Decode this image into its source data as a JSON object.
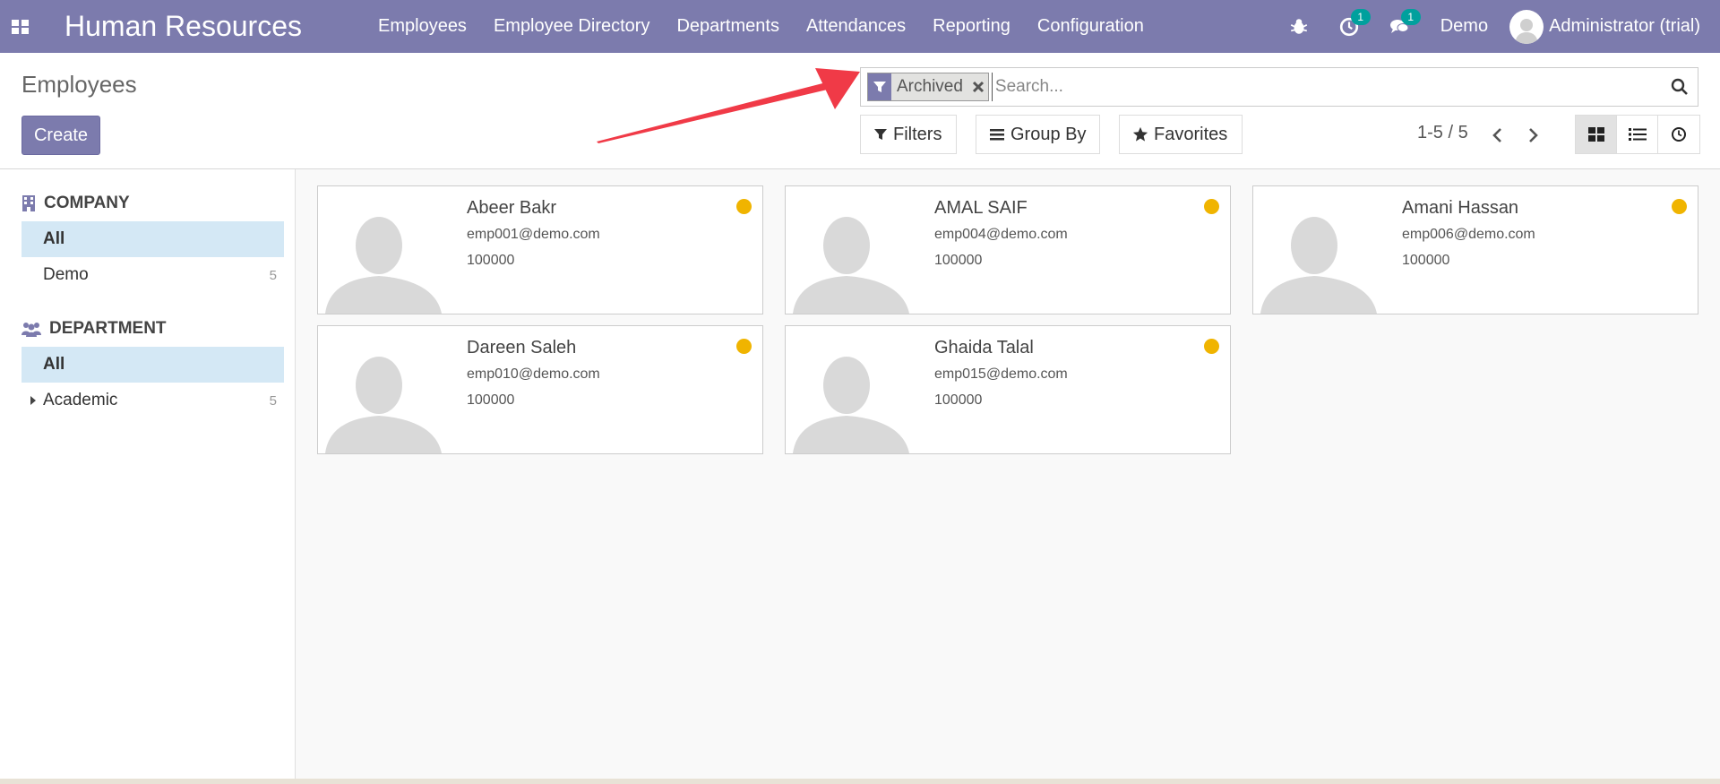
{
  "navbar": {
    "brand": "Human Resources",
    "menu": [
      "Employees",
      "Employee Directory",
      "Departments",
      "Attendances",
      "Reporting",
      "Configuration"
    ],
    "activity_count": "1",
    "message_count": "1",
    "company": "Demo",
    "user": "Administrator (trial)",
    "color": "#7c7bad"
  },
  "control_panel": {
    "title": "Employees",
    "create_label": "Create",
    "facet_label": "Archived",
    "search_placeholder": "Search...",
    "filters_label": "Filters",
    "groupby_label": "Group By",
    "favorites_label": "Favorites",
    "pager": "1-5 / 5",
    "active_view": "kanban"
  },
  "sidebar": {
    "company": {
      "header": "COMPANY",
      "items": [
        {
          "label": "All",
          "count": ""
        },
        {
          "label": "Demo",
          "count": "5"
        }
      ]
    },
    "department": {
      "header": "DEPARTMENT",
      "items": [
        {
          "label": "All",
          "count": ""
        },
        {
          "label": "Academic",
          "count": "5"
        }
      ]
    }
  },
  "employees": [
    {
      "name": "Abeer Bakr",
      "email": "emp001@demo.com",
      "phone": "100000"
    },
    {
      "name": "AMAL SAIF",
      "email": "emp004@demo.com",
      "phone": "100000"
    },
    {
      "name": "Amani Hassan",
      "email": "emp006@demo.com",
      "phone": "100000"
    },
    {
      "name": "Dareen Saleh",
      "email": "emp010@demo.com",
      "phone": "100000"
    },
    {
      "name": "Ghaida Talal",
      "email": "emp015@demo.com",
      "phone": "100000"
    }
  ],
  "colors": {
    "status_dot": "#f0b400",
    "annotation_arrow": "#f03a47",
    "active_filter_bg": "#d4e8f5"
  }
}
